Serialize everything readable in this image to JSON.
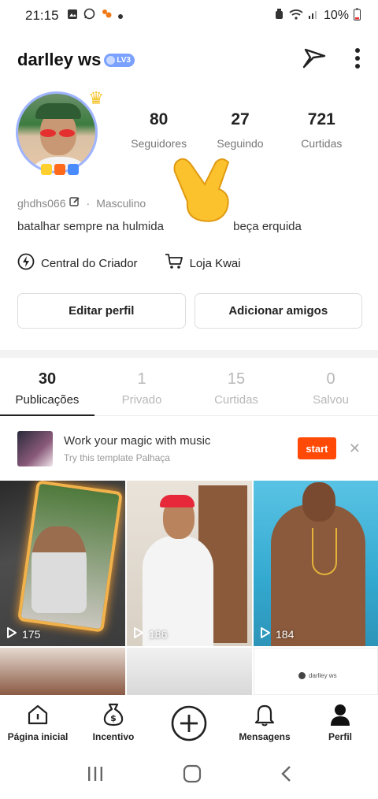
{
  "status_bar": {
    "time": "21:15",
    "battery": "10%"
  },
  "profile": {
    "username": "darlley ws",
    "level_badge": "LV3",
    "stats": [
      {
        "value": "80",
        "label": "Seguidores"
      },
      {
        "value": "27",
        "label": "Seguindo"
      },
      {
        "value": "721",
        "label": "Curtidas"
      }
    ],
    "handle": "ghdhs066",
    "gender": "Masculino",
    "bio": "batalhar sempre na hulmida",
    "bio_end": "beça erquida",
    "links": {
      "creator_center": "Central do Criador",
      "shop": "Loja Kwai"
    },
    "buttons": {
      "edit": "Editar perfil",
      "add_friends": "Adicionar amigos"
    }
  },
  "tabs": [
    {
      "count": "30",
      "label": "Publicações",
      "active": true
    },
    {
      "count": "1",
      "label": "Privado",
      "active": false
    },
    {
      "count": "15",
      "label": "Curtidas",
      "active": false
    },
    {
      "count": "0",
      "label": "Salvou",
      "active": false
    }
  ],
  "banner": {
    "title": "Work your magic with music",
    "subtitle": "Try this template Palhaça",
    "start_label": "start"
  },
  "videos": [
    {
      "views": "175"
    },
    {
      "views": "186"
    },
    {
      "views": "184"
    }
  ],
  "mini_profile_name": "darlley ws",
  "bottom_nav": {
    "home": "Página inicial",
    "incentive": "Incentivo",
    "messages": "Mensagens",
    "profile": "Perfil"
  },
  "colors": {
    "accent": "#ff4906",
    "level_badge": "#7aa1ff",
    "text_muted": "#777777"
  },
  "icons": [
    "signal-icon",
    "wifi-icon",
    "battery-icon",
    "share-icon",
    "more-icon",
    "edit-icon",
    "lightning-icon",
    "cart-icon",
    "play-icon",
    "home-icon",
    "money-bag-icon",
    "plus-icon",
    "bell-icon",
    "user-icon"
  ]
}
